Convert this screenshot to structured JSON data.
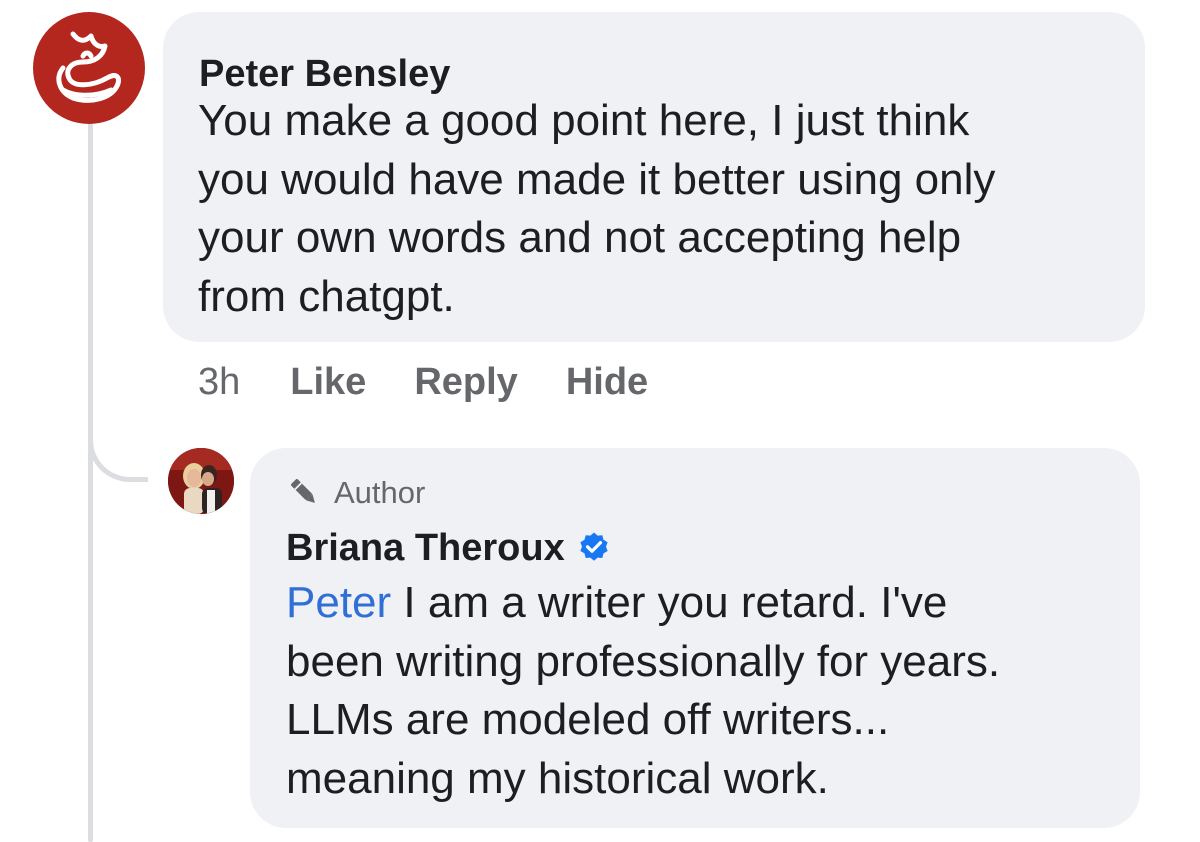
{
  "colors": {
    "bubble_background": "#f0f1f5",
    "text_primary": "#1c1e21",
    "text_secondary": "#65676b",
    "mention_link": "#2f6fd6",
    "verified_badge": "#1877f2",
    "peter_avatar": "#b3271f",
    "thread_line": "#dcdde1"
  },
  "comment": {
    "author": "Peter Bensley",
    "lines": [
      "You make a good point here, I just think",
      "you would have made it better using only",
      "your own words and not accepting help",
      "from chatgpt."
    ],
    "timestamp": "3h",
    "actions": {
      "like": "Like",
      "reply": "Reply",
      "hide": "Hide"
    }
  },
  "reply": {
    "badge_label": "Author",
    "badge_icon": "pencil-icon",
    "author": "Briana Theroux",
    "verified_icon": "verified-check-icon",
    "mention": "Peter",
    "first_line_rest": " I am a writer you retard. I've",
    "lines": [
      "been writing professionally for years.",
      "LLMs are modeled off writers...",
      "meaning my historical work."
    ]
  }
}
